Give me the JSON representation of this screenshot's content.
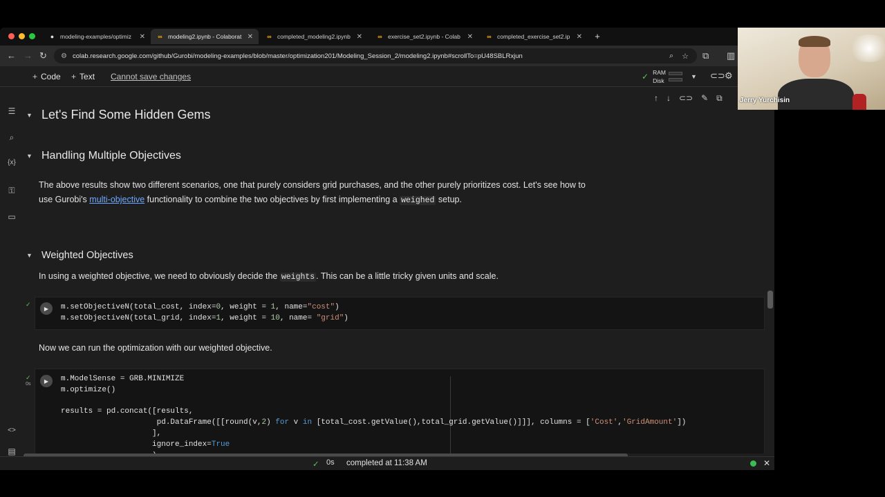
{
  "browser": {
    "tabs": [
      {
        "title": "modeling-examples/optimiz",
        "icon": "github-icon",
        "active": false
      },
      {
        "title": "modeling2.ipynb - Colaborat",
        "icon": "colab-icon",
        "active": true
      },
      {
        "title": "completed_modeling2.ipynb",
        "icon": "colab-icon",
        "active": false
      },
      {
        "title": "exercise_set2.ipynb - Colab",
        "icon": "colab-icon",
        "active": false
      },
      {
        "title": "completed_exercise_set2.ip",
        "icon": "colab-icon",
        "active": false
      }
    ],
    "url": "colab.research.google.com/github/Gurobi/modeling-examples/blob/master/optimization201/Modeling_Session_2/modeling2.ipynb#scrollTo=pU48SBLRxjun"
  },
  "toolbar": {
    "code_label": "Code",
    "text_label": "Text",
    "cannot_save": "Cannot save changes",
    "ram_label": "RAM",
    "disk_label": "Disk"
  },
  "notebook": {
    "h1": "Let's Find Some Hidden Gems",
    "h2": "Handling Multiple Objectives",
    "p1_a": "The above results show two different scenarios, one that purely considers grid purchases, and the other purely prioritizes cost. Let's see how to",
    "p1_b": "use Gurobi's",
    "p1_link": "multi-objective",
    "p1_c": "functionality to combine the two objectives by first implementing a",
    "p1_code": "weighed",
    "p1_d": "setup.",
    "h3": "Weighted Objectives",
    "p2_a": "In using a weighted objective, we need to obviously decide the",
    "p2_code": "weights",
    "p2_b": ". This can be a little tricky given units and scale.",
    "p3": "Now we can run the optimization with our weighted objective.",
    "cell1_status": "✓",
    "cell2_status": "✓",
    "cell2_time": "0s"
  },
  "statusbar": {
    "check": "✓",
    "time": "0s",
    "text": "completed at 11:38 AM"
  },
  "webcam": {
    "name": "Jerry Yurchisin"
  }
}
